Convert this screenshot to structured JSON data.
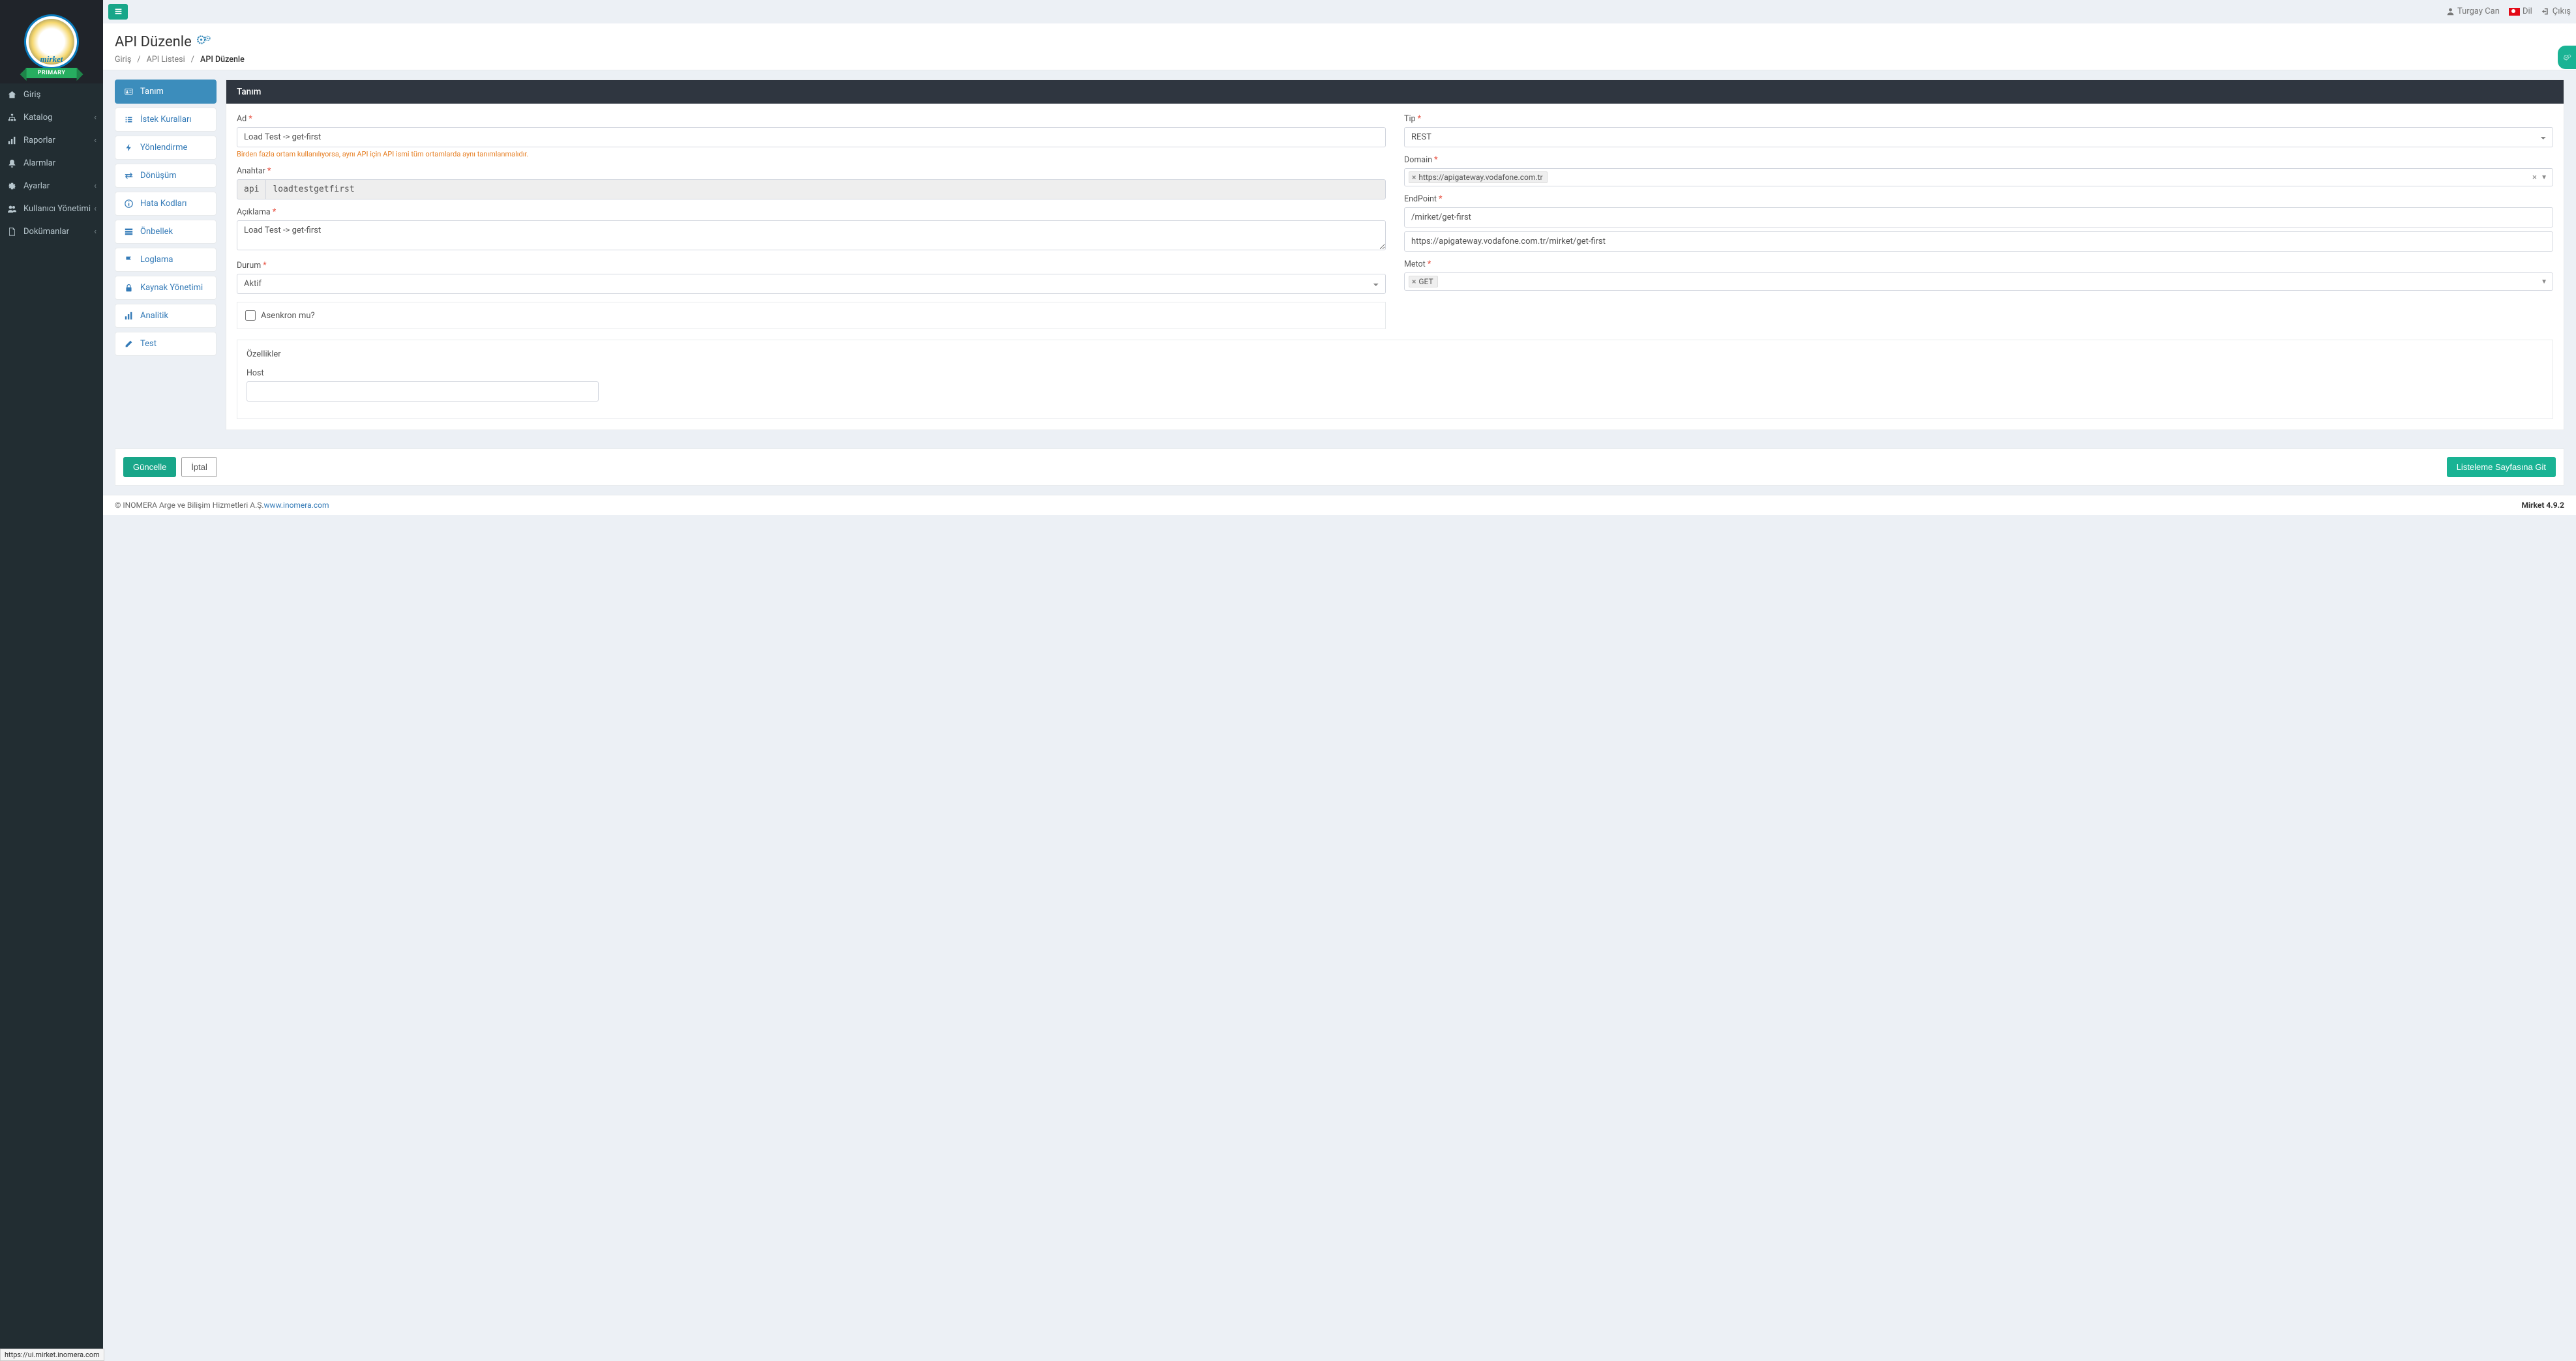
{
  "brand": {
    "name": "mirket",
    "badge": "PRIMARY"
  },
  "topbar": {
    "user": "Turgay Can",
    "lang": "Dil",
    "logout": "Çıkış"
  },
  "nav": {
    "items": [
      {
        "label": "Giriş",
        "icon": "home",
        "arrow": false
      },
      {
        "label": "Katalog",
        "icon": "sitemap",
        "arrow": true
      },
      {
        "label": "Raporlar",
        "icon": "chart",
        "arrow": true
      },
      {
        "label": "Alarmlar",
        "icon": "bell",
        "arrow": false
      },
      {
        "label": "Ayarlar",
        "icon": "gear",
        "arrow": true
      },
      {
        "label": "Kullanıcı Yönetimi",
        "icon": "users",
        "arrow": true
      },
      {
        "label": "Dokümanlar",
        "icon": "doc",
        "arrow": true
      }
    ]
  },
  "page": {
    "title": "API Düzenle",
    "breadcrumb": [
      {
        "label": "Giriş",
        "active": false
      },
      {
        "label": "API Listesi",
        "active": false
      },
      {
        "label": "API Düzenle",
        "active": true
      }
    ]
  },
  "sideTabs": [
    {
      "label": "Tanım",
      "icon": "id-card",
      "active": true
    },
    {
      "label": "İstek Kuralları",
      "icon": "list",
      "active": false
    },
    {
      "label": "Yönlendirme",
      "icon": "bolt",
      "active": false
    },
    {
      "label": "Dönüşüm",
      "icon": "exchange",
      "active": false
    },
    {
      "label": "Hata Kodları",
      "icon": "info",
      "active": false
    },
    {
      "label": "Önbellek",
      "icon": "storage",
      "active": false
    },
    {
      "label": "Loglama",
      "icon": "flag",
      "active": false
    },
    {
      "label": "Kaynak Yönetimi",
      "icon": "lock",
      "active": false
    },
    {
      "label": "Analitik",
      "icon": "chart",
      "active": false
    },
    {
      "label": "Test",
      "icon": "pencil",
      "active": false
    }
  ],
  "form": {
    "panelTitle": "Tanım",
    "left": {
      "ad": {
        "label": "Ad",
        "value": "Load Test -> get-first",
        "hint": "Birden fazla ortam kullanılıyorsa, aynı API için API ismi tüm ortamlarda aynı tanımlanmalıdır."
      },
      "anahtar": {
        "label": "Anahtar",
        "prefix": "api",
        "value": "loadtestgetfirst"
      },
      "aciklama": {
        "label": "Açıklama",
        "value": "Load Test -> get-first"
      },
      "durum": {
        "label": "Durum",
        "value": "Aktif"
      },
      "asenkron": {
        "label": "Asenkron mu?",
        "checked": false
      }
    },
    "right": {
      "tip": {
        "label": "Tip",
        "value": "REST"
      },
      "domain": {
        "label": "Domain",
        "tags": [
          "https://apigateway.vodafone.com.tr"
        ]
      },
      "endpoint": {
        "label": "EndPoint",
        "value": "/mirket/get-first",
        "resolved": "https://apigateway.vodafone.com.tr/mirket/get-first"
      },
      "metot": {
        "label": "Metot",
        "tags": [
          "GET"
        ]
      }
    },
    "features": {
      "title": "Özellikler",
      "host": {
        "label": "Host",
        "value": ""
      }
    }
  },
  "actions": {
    "update": "Güncelle",
    "cancel": "İptal",
    "list": "Listeleme Sayfasına Git"
  },
  "footer": {
    "copyright": "© INOMERA Arge ve Bilişim Hizmetleri A.Ş. ",
    "link": "www.inomera.com",
    "version": "Mirket 4.9.2"
  },
  "statusUrl": "https://ui.mirket.inomera.com"
}
